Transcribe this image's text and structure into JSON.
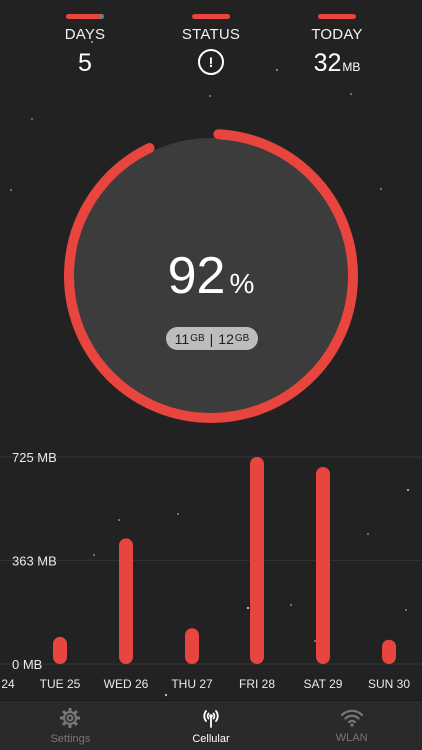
{
  "stats": {
    "days": {
      "label": "DAYS",
      "value": "5",
      "fill_fraction": 0.88
    },
    "status": {
      "label": "STATUS",
      "icon": "alert-circle-icon"
    },
    "today": {
      "label": "TODAY",
      "value": "32",
      "unit": "MB"
    }
  },
  "gauge": {
    "percent": "92",
    "percent_sign": "%",
    "fill_fraction": 0.92,
    "used_value": "11",
    "used_unit": "GB",
    "separator": "|",
    "total_value": "12",
    "total_unit": "GB",
    "colors": {
      "ring": "#e8453f",
      "disk": "#3c3c3c",
      "pill": "#bdbdbd"
    }
  },
  "chart_data": {
    "type": "bar",
    "categories": [
      "24",
      "TUE 25",
      "WED 26",
      "THU 27",
      "FRI 28",
      "SAT 29",
      "SUN 30"
    ],
    "values": [
      null,
      95,
      440,
      125,
      725,
      690,
      85
    ],
    "unit": "MB",
    "y_tick_labels": [
      "725 MB",
      "363  MB",
      "0 MB"
    ],
    "y_ticks": [
      725,
      363,
      0
    ],
    "ylim": [
      0,
      725
    ],
    "grid": true,
    "bar_color": "#e8453f"
  },
  "tabbar": {
    "tabs": [
      {
        "label": "Settings",
        "icon": "gear-icon",
        "active": false
      },
      {
        "label": "Cellular",
        "icon": "antenna-icon",
        "active": true
      },
      {
        "label": "WLAN",
        "icon": "wifi-icon",
        "active": false
      }
    ]
  }
}
